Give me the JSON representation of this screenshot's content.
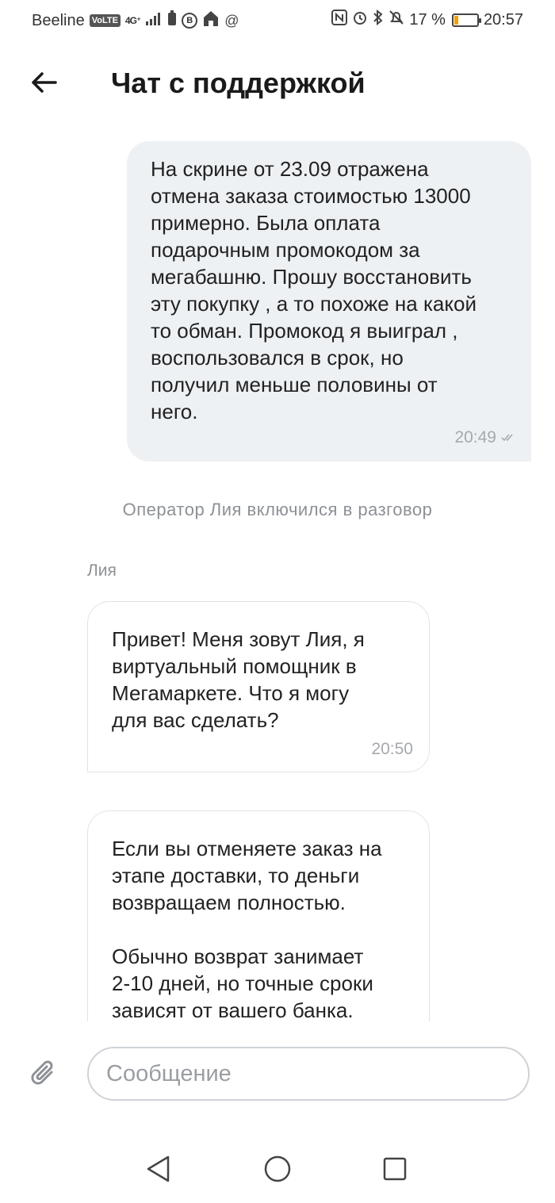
{
  "status_bar": {
    "carrier": "Beeline",
    "volte": "VoLTE",
    "network": "4G⁺",
    "battery_percent": "17 %",
    "time": "20:57"
  },
  "header": {
    "title": "Чат с поддержкой"
  },
  "messages": {
    "user_message": {
      "text": "На скрине от 23.09 отражена\nотмена заказа стоимостью 13000\nпримерно. Была оплата\nподарочным промокодом за\nмегабашню. Прошу восстановить\nэту покупку , а то похоже на какой\nто обман. Промокод я выиграл ,\nвоспользовался в срок, но\nполучил меньше половины от\nнего.",
      "time": "20:49"
    },
    "system_notice": "Оператор Лия включился в разговор",
    "operator_name": "Лия",
    "operator_message_1": {
      "text": "Привет! Меня зовут Лия, я\nвиртуальный помощник в\nМегамаркете. Что я могу\nдля вас сделать?",
      "time": "20:50"
    },
    "operator_message_2": {
      "paragraph_1": "Если вы отменяете заказ на\nэтапе доставки, то деньги\nвозвращаем полностью.",
      "paragraph_2": "Обычно возврат занимает\n2-10 дней, но точные сроки\nзависят от вашего банка."
    }
  },
  "input": {
    "placeholder": "Сообщение"
  },
  "colors": {
    "outgoing_bubble": "#eef1f4",
    "muted_text": "#8d9196",
    "border": "#e0e3e7"
  }
}
